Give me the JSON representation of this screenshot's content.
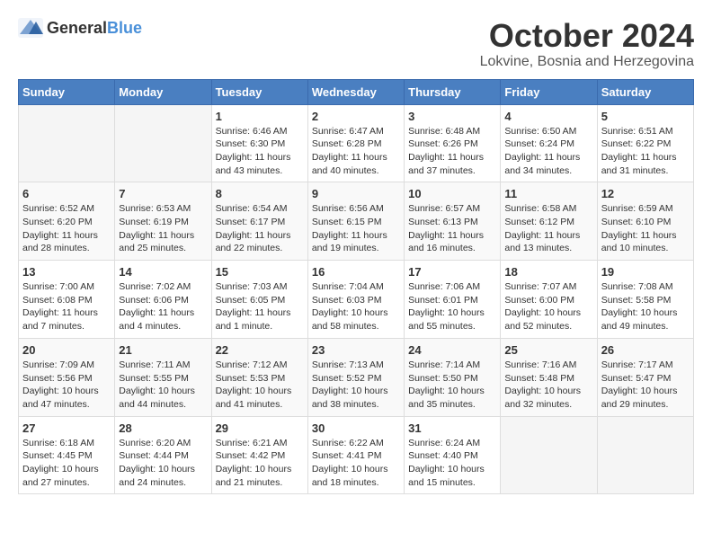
{
  "header": {
    "logo_general": "General",
    "logo_blue": "Blue",
    "month_title": "October 2024",
    "location": "Lokvine, Bosnia and Herzegovina"
  },
  "weekdays": [
    "Sunday",
    "Monday",
    "Tuesday",
    "Wednesday",
    "Thursday",
    "Friday",
    "Saturday"
  ],
  "weeks": [
    [
      {
        "day": "",
        "sunrise": "",
        "sunset": "",
        "daylight": ""
      },
      {
        "day": "",
        "sunrise": "",
        "sunset": "",
        "daylight": ""
      },
      {
        "day": "1",
        "sunrise": "Sunrise: 6:46 AM",
        "sunset": "Sunset: 6:30 PM",
        "daylight": "Daylight: 11 hours and 43 minutes."
      },
      {
        "day": "2",
        "sunrise": "Sunrise: 6:47 AM",
        "sunset": "Sunset: 6:28 PM",
        "daylight": "Daylight: 11 hours and 40 minutes."
      },
      {
        "day": "3",
        "sunrise": "Sunrise: 6:48 AM",
        "sunset": "Sunset: 6:26 PM",
        "daylight": "Daylight: 11 hours and 37 minutes."
      },
      {
        "day": "4",
        "sunrise": "Sunrise: 6:50 AM",
        "sunset": "Sunset: 6:24 PM",
        "daylight": "Daylight: 11 hours and 34 minutes."
      },
      {
        "day": "5",
        "sunrise": "Sunrise: 6:51 AM",
        "sunset": "Sunset: 6:22 PM",
        "daylight": "Daylight: 11 hours and 31 minutes."
      }
    ],
    [
      {
        "day": "6",
        "sunrise": "Sunrise: 6:52 AM",
        "sunset": "Sunset: 6:20 PM",
        "daylight": "Daylight: 11 hours and 28 minutes."
      },
      {
        "day": "7",
        "sunrise": "Sunrise: 6:53 AM",
        "sunset": "Sunset: 6:19 PM",
        "daylight": "Daylight: 11 hours and 25 minutes."
      },
      {
        "day": "8",
        "sunrise": "Sunrise: 6:54 AM",
        "sunset": "Sunset: 6:17 PM",
        "daylight": "Daylight: 11 hours and 22 minutes."
      },
      {
        "day": "9",
        "sunrise": "Sunrise: 6:56 AM",
        "sunset": "Sunset: 6:15 PM",
        "daylight": "Daylight: 11 hours and 19 minutes."
      },
      {
        "day": "10",
        "sunrise": "Sunrise: 6:57 AM",
        "sunset": "Sunset: 6:13 PM",
        "daylight": "Daylight: 11 hours and 16 minutes."
      },
      {
        "day": "11",
        "sunrise": "Sunrise: 6:58 AM",
        "sunset": "Sunset: 6:12 PM",
        "daylight": "Daylight: 11 hours and 13 minutes."
      },
      {
        "day": "12",
        "sunrise": "Sunrise: 6:59 AM",
        "sunset": "Sunset: 6:10 PM",
        "daylight": "Daylight: 11 hours and 10 minutes."
      }
    ],
    [
      {
        "day": "13",
        "sunrise": "Sunrise: 7:00 AM",
        "sunset": "Sunset: 6:08 PM",
        "daylight": "Daylight: 11 hours and 7 minutes."
      },
      {
        "day": "14",
        "sunrise": "Sunrise: 7:02 AM",
        "sunset": "Sunset: 6:06 PM",
        "daylight": "Daylight: 11 hours and 4 minutes."
      },
      {
        "day": "15",
        "sunrise": "Sunrise: 7:03 AM",
        "sunset": "Sunset: 6:05 PM",
        "daylight": "Daylight: 11 hours and 1 minute."
      },
      {
        "day": "16",
        "sunrise": "Sunrise: 7:04 AM",
        "sunset": "Sunset: 6:03 PM",
        "daylight": "Daylight: 10 hours and 58 minutes."
      },
      {
        "day": "17",
        "sunrise": "Sunrise: 7:06 AM",
        "sunset": "Sunset: 6:01 PM",
        "daylight": "Daylight: 10 hours and 55 minutes."
      },
      {
        "day": "18",
        "sunrise": "Sunrise: 7:07 AM",
        "sunset": "Sunset: 6:00 PM",
        "daylight": "Daylight: 10 hours and 52 minutes."
      },
      {
        "day": "19",
        "sunrise": "Sunrise: 7:08 AM",
        "sunset": "Sunset: 5:58 PM",
        "daylight": "Daylight: 10 hours and 49 minutes."
      }
    ],
    [
      {
        "day": "20",
        "sunrise": "Sunrise: 7:09 AM",
        "sunset": "Sunset: 5:56 PM",
        "daylight": "Daylight: 10 hours and 47 minutes."
      },
      {
        "day": "21",
        "sunrise": "Sunrise: 7:11 AM",
        "sunset": "Sunset: 5:55 PM",
        "daylight": "Daylight: 10 hours and 44 minutes."
      },
      {
        "day": "22",
        "sunrise": "Sunrise: 7:12 AM",
        "sunset": "Sunset: 5:53 PM",
        "daylight": "Daylight: 10 hours and 41 minutes."
      },
      {
        "day": "23",
        "sunrise": "Sunrise: 7:13 AM",
        "sunset": "Sunset: 5:52 PM",
        "daylight": "Daylight: 10 hours and 38 minutes."
      },
      {
        "day": "24",
        "sunrise": "Sunrise: 7:14 AM",
        "sunset": "Sunset: 5:50 PM",
        "daylight": "Daylight: 10 hours and 35 minutes."
      },
      {
        "day": "25",
        "sunrise": "Sunrise: 7:16 AM",
        "sunset": "Sunset: 5:48 PM",
        "daylight": "Daylight: 10 hours and 32 minutes."
      },
      {
        "day": "26",
        "sunrise": "Sunrise: 7:17 AM",
        "sunset": "Sunset: 5:47 PM",
        "daylight": "Daylight: 10 hours and 29 minutes."
      }
    ],
    [
      {
        "day": "27",
        "sunrise": "Sunrise: 6:18 AM",
        "sunset": "Sunset: 4:45 PM",
        "daylight": "Daylight: 10 hours and 27 minutes."
      },
      {
        "day": "28",
        "sunrise": "Sunrise: 6:20 AM",
        "sunset": "Sunset: 4:44 PM",
        "daylight": "Daylight: 10 hours and 24 minutes."
      },
      {
        "day": "29",
        "sunrise": "Sunrise: 6:21 AM",
        "sunset": "Sunset: 4:42 PM",
        "daylight": "Daylight: 10 hours and 21 minutes."
      },
      {
        "day": "30",
        "sunrise": "Sunrise: 6:22 AM",
        "sunset": "Sunset: 4:41 PM",
        "daylight": "Daylight: 10 hours and 18 minutes."
      },
      {
        "day": "31",
        "sunrise": "Sunrise: 6:24 AM",
        "sunset": "Sunset: 4:40 PM",
        "daylight": "Daylight: 10 hours and 15 minutes."
      },
      {
        "day": "",
        "sunrise": "",
        "sunset": "",
        "daylight": ""
      },
      {
        "day": "",
        "sunrise": "",
        "sunset": "",
        "daylight": ""
      }
    ]
  ]
}
